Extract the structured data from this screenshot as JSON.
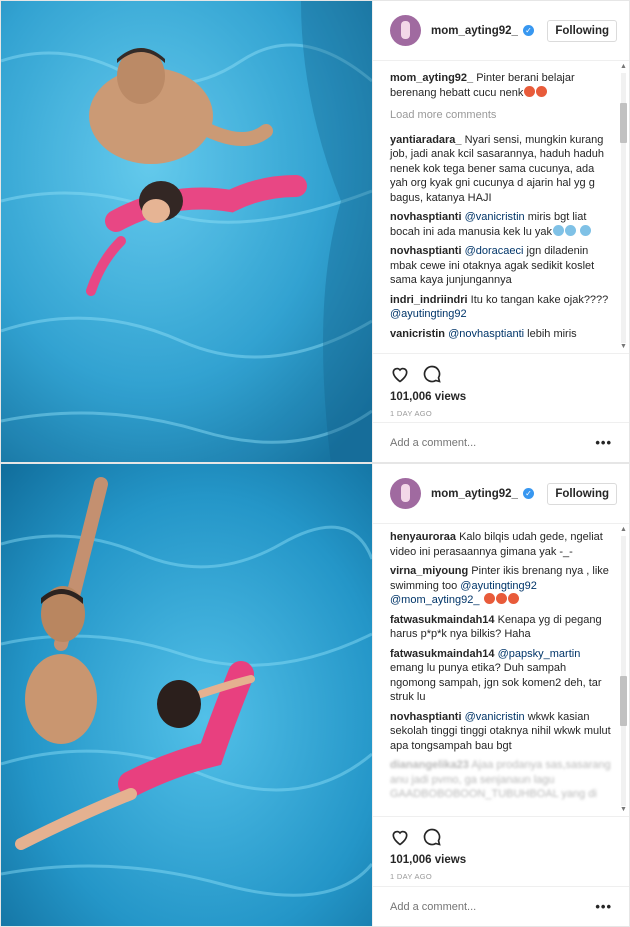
{
  "post1": {
    "username": "mom_ayting92_",
    "follow_label": "Following",
    "caption_user": "mom_ayting92_",
    "caption_text": " Pinter berani belajar berenang hebatt cucu nenk",
    "load_more": "Load more comments",
    "comments": [
      {
        "user": "yantiaradara_",
        "parts": [
          " Nyari sensi, mungkin kurang job, jadi anak kcil sasarannya, haduh haduh nenek kok tega bener sama cucunya, ada yah org kyak gni cucunya d ajarin hal yg g bagus, katanya HAJI"
        ]
      },
      {
        "user": "novhasptianti",
        "mention": "@vanicristin",
        "text": " miris bgt liat bocah ini ada manusia kek lu yak"
      },
      {
        "user": "novhasptianti",
        "mention": "@doracaeci",
        "text": " jgn diladenin mbak cewe ini otaknya agak sedikit koslet sama kaya junjungannya"
      },
      {
        "user": "indri_indriindri",
        "text": " Itu ko tangan kake ojak???? ",
        "mention_after": "@ayutingting92"
      },
      {
        "user": "vanicristin",
        "mention": "@novhasptianti",
        "text": " lebih miris"
      }
    ],
    "views": "101,006 views",
    "time": "1 DAY AGO",
    "add_comment_placeholder": "Add a comment...",
    "more_icon": "•••"
  },
  "post2": {
    "username": "mom_ayting92_",
    "follow_label": "Following",
    "comments": [
      {
        "user": "henyauroraa",
        "text": " Kalo bilqis udah gede, ngeliat video ini perasaannya gimana yak -_-"
      },
      {
        "user": "virna_miyoung",
        "text": " Pinter ikis brenang nya , like swimming too ",
        "mention": "@ayutingting92",
        "mention2": "@mom_ayting92_"
      },
      {
        "user": "fatwasukmaindah14",
        "text": " Kenapa yg di pegang harus p*p*k nya bilkis? Haha"
      },
      {
        "user": "fatwasukmaindah14",
        "mention": "@papsky_martin",
        "text": " emang lu punya etika? Duh sampah ngomong sampah, jgn sok komen2 deh, tar struk lu"
      },
      {
        "user": "novhasptianti",
        "mention": "@vanicristin",
        "text": " wkwk kasian sekolah tinggi tinggi otaknya nihil wkwk mulut apa tongsampah bau bgt"
      },
      {
        "user": "dianangelika23",
        "text": " Ajaa prodanya sas,sasarang anu jadi pvmo, ga senjanaun lagu GAADBOBOBOON_TUBUHBOAL yang di"
      }
    ],
    "views": "101,006 views",
    "time": "1 DAY AGO",
    "add_comment_placeholder": "Add a comment...",
    "more_icon": "•••"
  },
  "icons": {
    "heart": "heart-icon",
    "comment": "comment-icon",
    "verified": "verified-badge-icon"
  },
  "colors": {
    "pool": "#2a9fd0",
    "link": "#003569",
    "verified": "#3897f0"
  }
}
